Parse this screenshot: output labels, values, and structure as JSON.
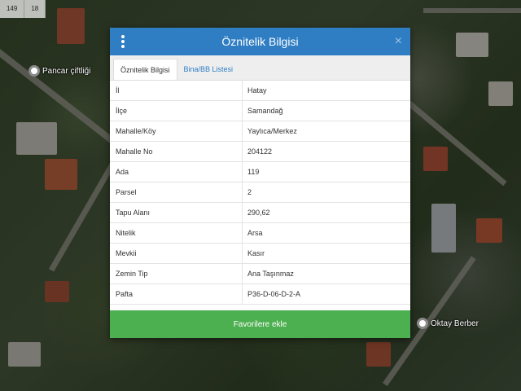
{
  "scale": {
    "left": "149",
    "right": "18"
  },
  "map_labels": {
    "poi_1": "Pancar çiftliği",
    "poi_2": "Oktay Berber"
  },
  "modal": {
    "title": "Öznitelik Bilgisi",
    "close_symbol": "×",
    "tabs": [
      {
        "label": "Öznitelik Bilgisi",
        "active": true
      },
      {
        "label": "Bina/BB Listesi",
        "active": false
      }
    ],
    "rows": [
      {
        "key": "İl",
        "value": "Hatay"
      },
      {
        "key": "İlçe",
        "value": "Samandağ"
      },
      {
        "key": "Mahalle/Köy",
        "value": "Yaylıca/Merkez"
      },
      {
        "key": "Mahalle No",
        "value": "204122"
      },
      {
        "key": "Ada",
        "value": "119"
      },
      {
        "key": "Parsel",
        "value": "2"
      },
      {
        "key": "Tapu Alanı",
        "value": "290,62"
      },
      {
        "key": "Nitelik",
        "value": "Arsa"
      },
      {
        "key": "Mevkii",
        "value": "Kasır"
      },
      {
        "key": "Zemin Tip",
        "value": "Ana Taşınmaz"
      },
      {
        "key": "Pafta",
        "value": "P36-D-06-D-2-A"
      }
    ],
    "favorite_button": "Favorilere ekle"
  },
  "colors": {
    "header": "#2f7ec4",
    "button": "#4caf50"
  }
}
